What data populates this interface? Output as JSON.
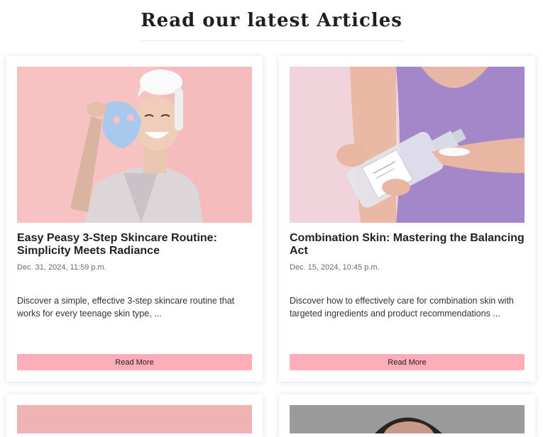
{
  "heading": "Read our latest Articles",
  "articles": [
    {
      "title": "Easy Peasy 3-Step Skincare Routine: Simplicity Meets Radiance",
      "date": "Dec. 31, 2024, 11:59 p.m.",
      "excerpt": "Discover a simple, effective 3-step skincare routine that works for every teenage skin type, ...",
      "button": "Read More",
      "image_icon": "woman-sheet-mask-photo"
    },
    {
      "title": "Combination Skin: Mastering the Balancing Act",
      "date": "Dec. 15, 2024, 10:45 p.m.",
      "excerpt": "Discover how to effectively care for combination skin with targeted ingredients and product recommendations ...",
      "button": "Read More",
      "image_icon": "toner-bottle-cotton-pad-photo"
    }
  ],
  "colors": {
    "button_bg": "#ffadb9",
    "heading": "#1f1f1f"
  }
}
